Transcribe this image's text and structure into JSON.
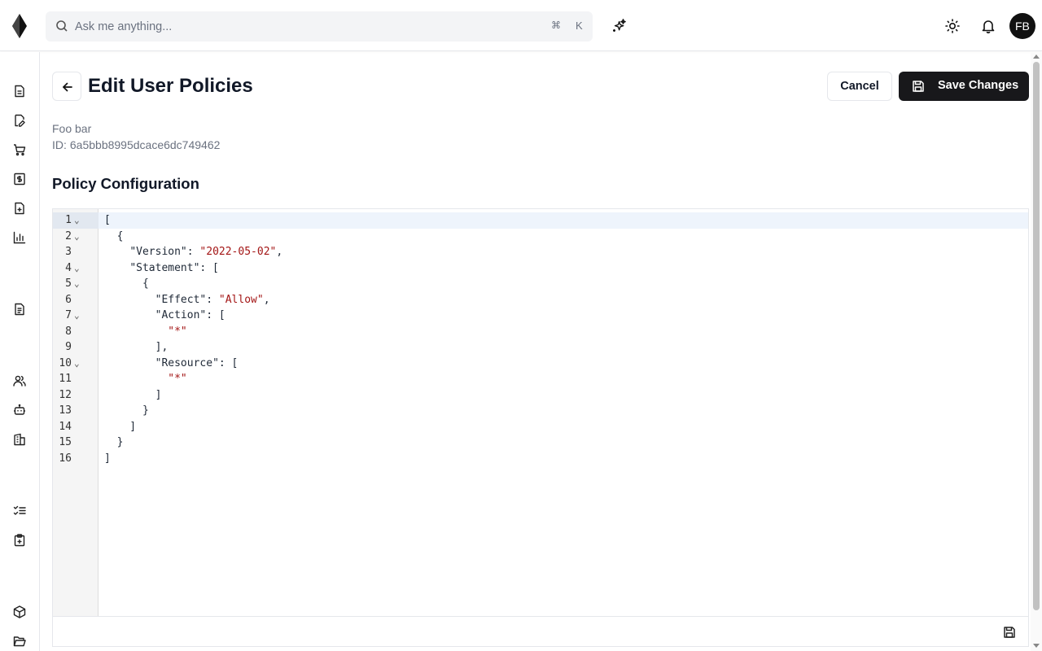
{
  "header": {
    "search_placeholder": "Ask me anything...",
    "shortcut_cmd": "⌘",
    "shortcut_key": "K",
    "avatar_initials": "FB"
  },
  "sidebar": {
    "items": [
      {
        "icon": "document-icon"
      },
      {
        "icon": "edit-document-icon"
      },
      {
        "icon": "cart-icon"
      },
      {
        "icon": "billing-icon"
      },
      {
        "icon": "add-document-icon"
      },
      {
        "icon": "bar-chart-icon"
      },
      {
        "icon": "list-document-icon"
      },
      {
        "icon": "users-icon"
      },
      {
        "icon": "bot-icon"
      },
      {
        "icon": "building-icon"
      },
      {
        "icon": "checklist-icon"
      },
      {
        "icon": "clipboard-icon"
      },
      {
        "icon": "package-icon"
      },
      {
        "icon": "folder-icon"
      }
    ]
  },
  "page": {
    "title": "Edit User Policies",
    "cancel_label": "Cancel",
    "save_label": "Save Changes",
    "user_name": "Foo bar",
    "id_label": "ID:",
    "id_value": "6a5bbb8995dcace6dc749462",
    "section_title": "Policy Configuration"
  },
  "editor": {
    "language": "json",
    "lines": [
      {
        "n": "1",
        "fold": true
      },
      {
        "n": "2",
        "fold": true
      },
      {
        "n": "3",
        "fold": false
      },
      {
        "n": "4",
        "fold": true
      },
      {
        "n": "5",
        "fold": true
      },
      {
        "n": "6",
        "fold": false
      },
      {
        "n": "7",
        "fold": true
      },
      {
        "n": "8",
        "fold": false
      },
      {
        "n": "9",
        "fold": false
      },
      {
        "n": "10",
        "fold": true
      },
      {
        "n": "11",
        "fold": false
      },
      {
        "n": "12",
        "fold": false
      },
      {
        "n": "13",
        "fold": false
      },
      {
        "n": "14",
        "fold": false
      },
      {
        "n": "15",
        "fold": false
      },
      {
        "n": "16",
        "fold": false
      }
    ],
    "policy": {
      "version_key": "\"Version\"",
      "version_value": "\"2022-05-02\"",
      "statement_key": "\"Statement\"",
      "effect_key": "\"Effect\"",
      "effect_value": "\"Allow\"",
      "action_key": "\"Action\"",
      "action_value": "\"*\"",
      "resource_key": "\"Resource\"",
      "resource_value": "\"*\""
    }
  },
  "colors": {
    "primary_button": "#18181b",
    "string_token": "#a31515",
    "active_line": "#eef4fc"
  }
}
